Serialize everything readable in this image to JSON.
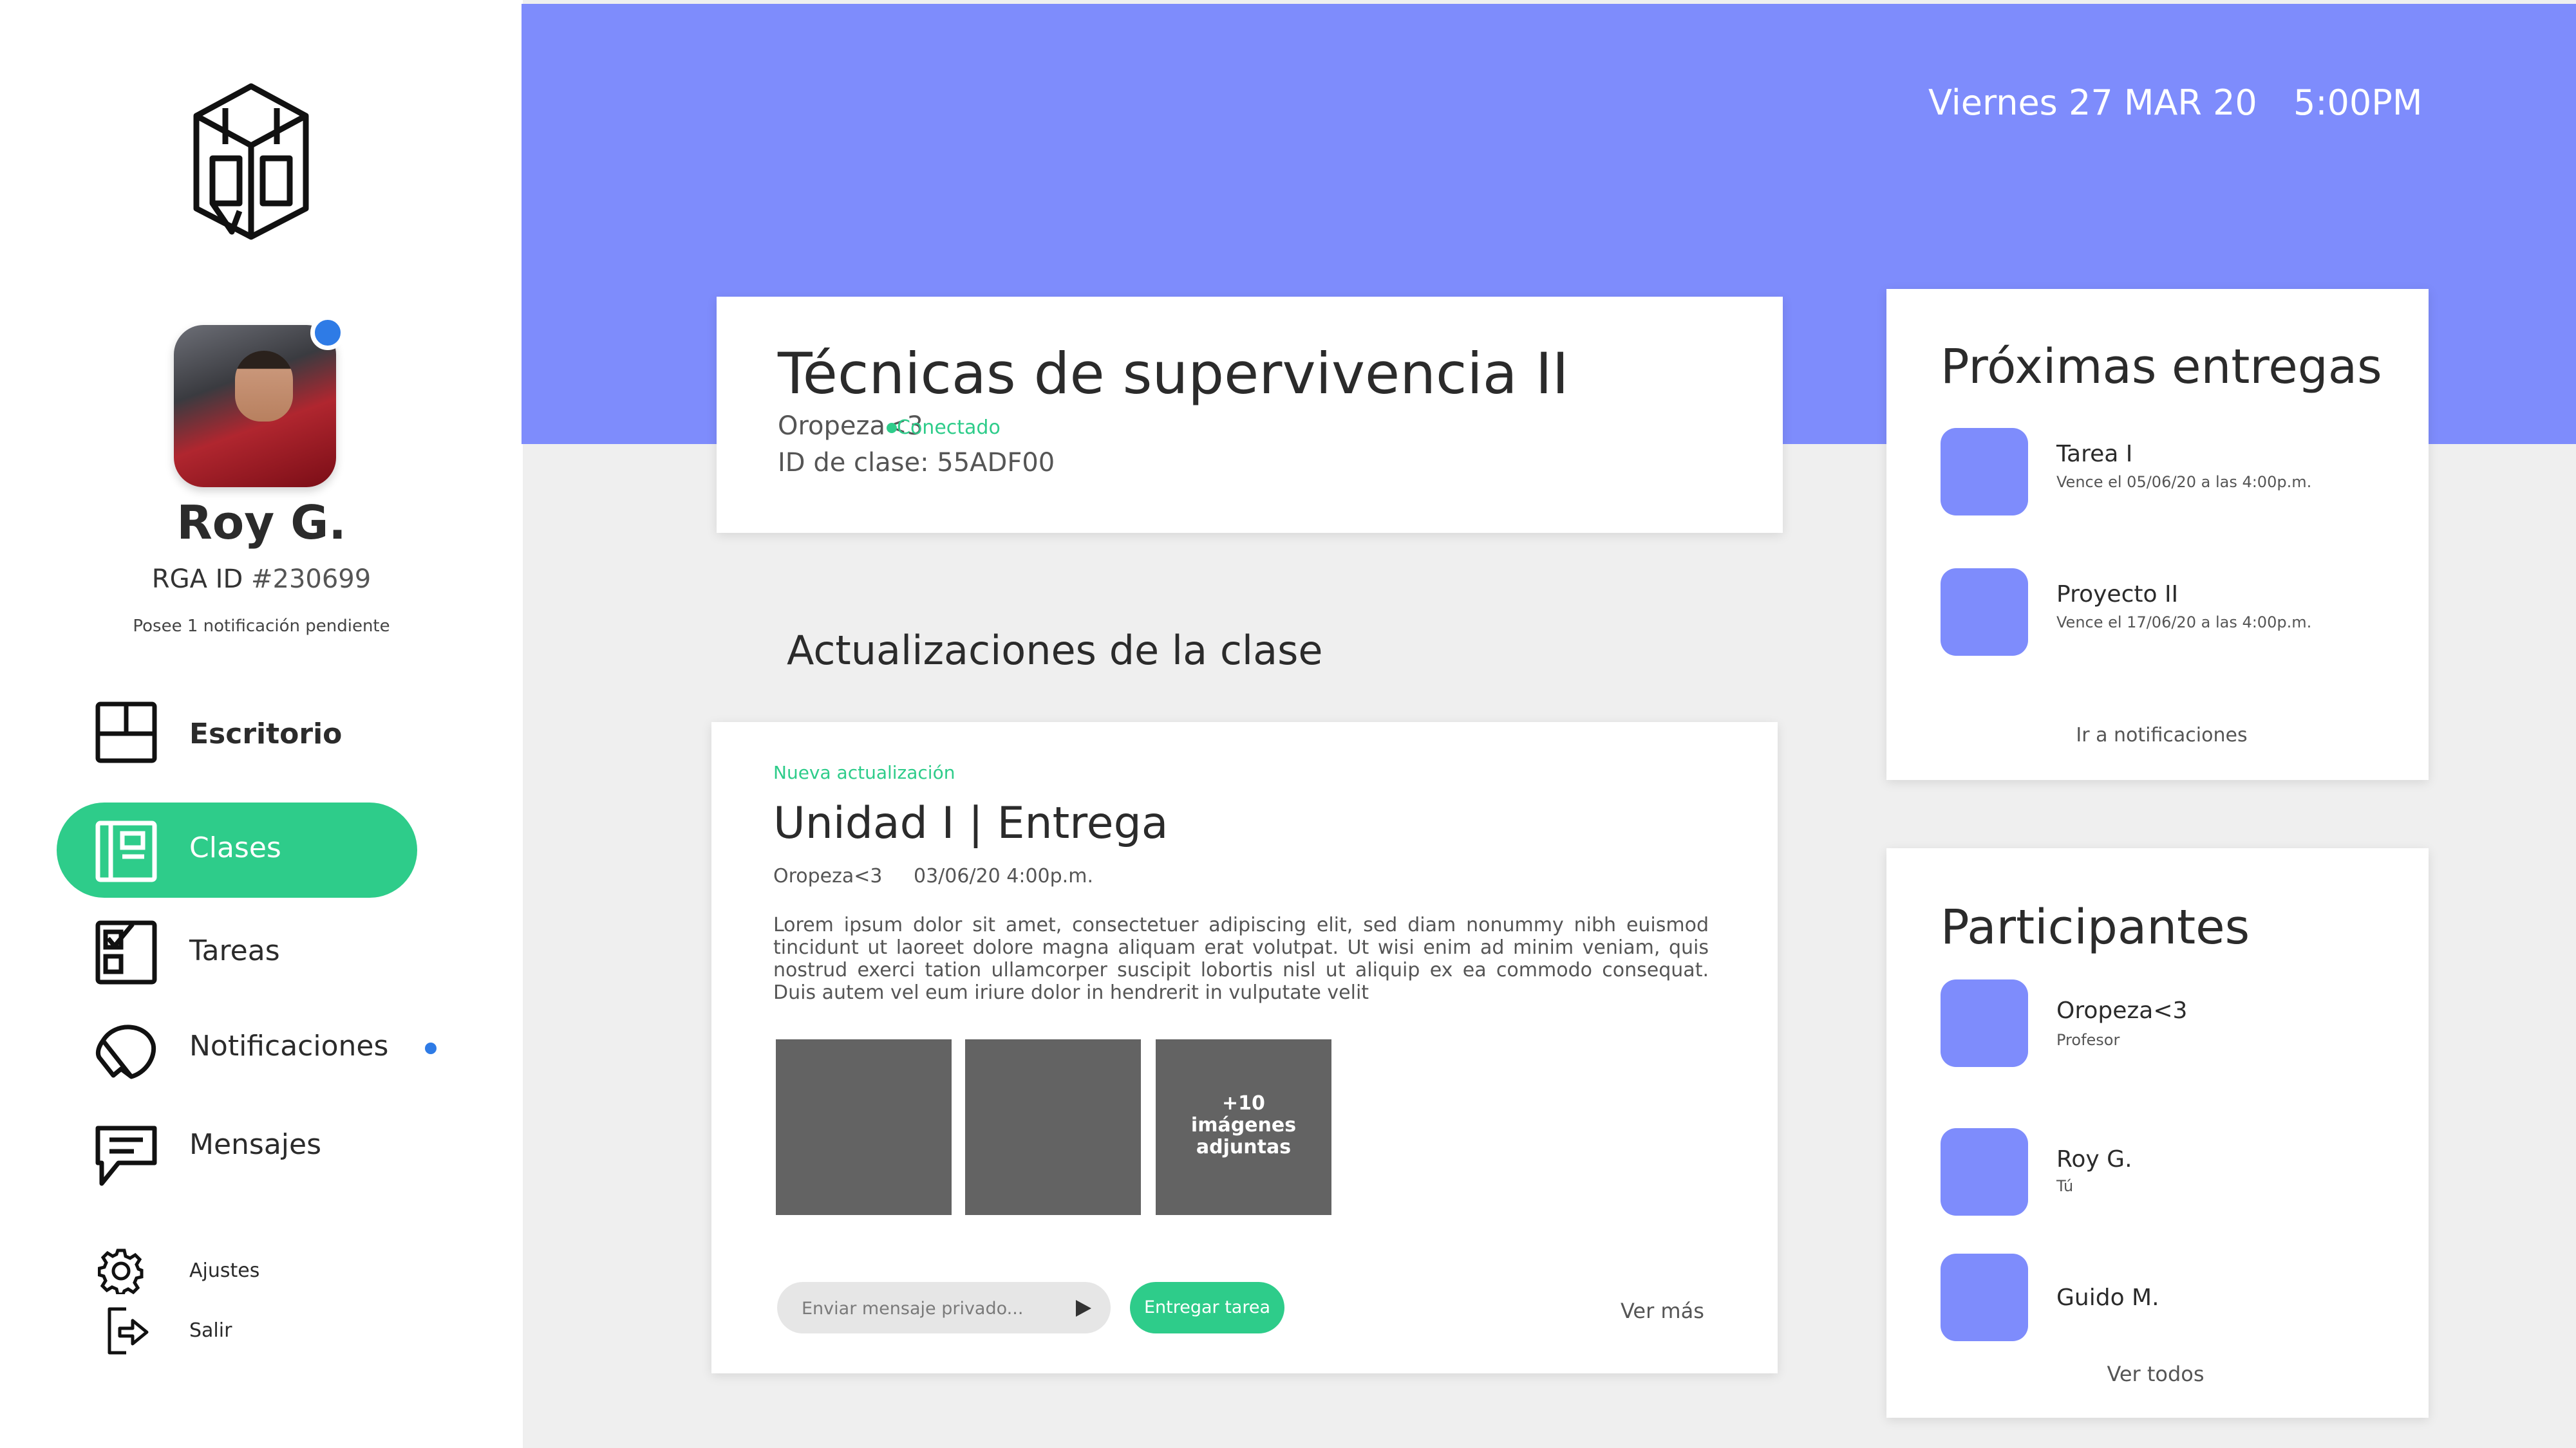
{
  "user": {
    "name": "Roy G.",
    "id_label": "RGA ID",
    "id_number": "#230699",
    "notification_text": "Posee 1 notificación pendiente"
  },
  "nav": {
    "escritorio": "Escritorio",
    "clases": "Clases",
    "tareas": "Tareas",
    "notificaciones": "Notificaciones",
    "mensajes": "Mensajes",
    "ajustes": "Ajustes",
    "salir": "Salir"
  },
  "header": {
    "date": "Viernes 27 MAR 20",
    "time": "5:00PM"
  },
  "class_card": {
    "title": "Técnicas de supervivencia II",
    "teacher": "Oropeza<3",
    "status": "Conectado",
    "class_id": "ID de clase: 55ADF00"
  },
  "updates": {
    "heading": "Actualizaciones de la clase",
    "tag": "Nueva actualización",
    "title": "Unidad I | Entrega",
    "author": "Oropeza<3",
    "date": "03/06/20 4:00p.m.",
    "body": "Lorem ipsum dolor sit amet, consectetuer adipiscing elit, sed diam nonummy nibh euismod tincidunt ut laoreet dolore magna aliquam erat volutpat. Ut wisi enim ad minim veniam, quis nostrud exerci tation ullamcorper suscipit lobortis nisl ut aliquip ex ea commodo consequat. Duis autem vel eum iriure dolor in hendrerit in vulputate velit",
    "more_images_count": "+10",
    "more_images_line1": "imágenes",
    "more_images_line2": "adjuntas",
    "message_placeholder": "Enviar mensaje privado...",
    "submit_label": "Entregar tarea",
    "see_more": "Ver más"
  },
  "deliveries": {
    "title": "Próximas entregas",
    "items": [
      {
        "title": "Tarea I",
        "due": "Vence el 05/06/20 a las 4:00p.m."
      },
      {
        "title": "Proyecto  II",
        "due": "Vence el 17/06/20 a las 4:00p.m."
      }
    ],
    "link": "Ir a notificaciones"
  },
  "participants": {
    "title": "Participantes",
    "items": [
      {
        "name": "Oropeza<3",
        "role": "Profesor"
      },
      {
        "name": "Roy G.",
        "role": "Tú"
      },
      {
        "name": "Guido M.",
        "role": ""
      }
    ],
    "link": "Ver todos"
  },
  "colors": {
    "accent_blue": "#7e8cfc",
    "accent_green": "#2ecc8a",
    "notification_dot": "#2e7be6",
    "thumbnail_gray": "#636363",
    "background_gray": "#efefef"
  },
  "icons": [
    "logo-icon",
    "desk-icon",
    "class-book-icon",
    "tasks-icon",
    "notifications-icon",
    "messages-icon",
    "settings-gear-icon",
    "logout-icon",
    "send-icon"
  ]
}
